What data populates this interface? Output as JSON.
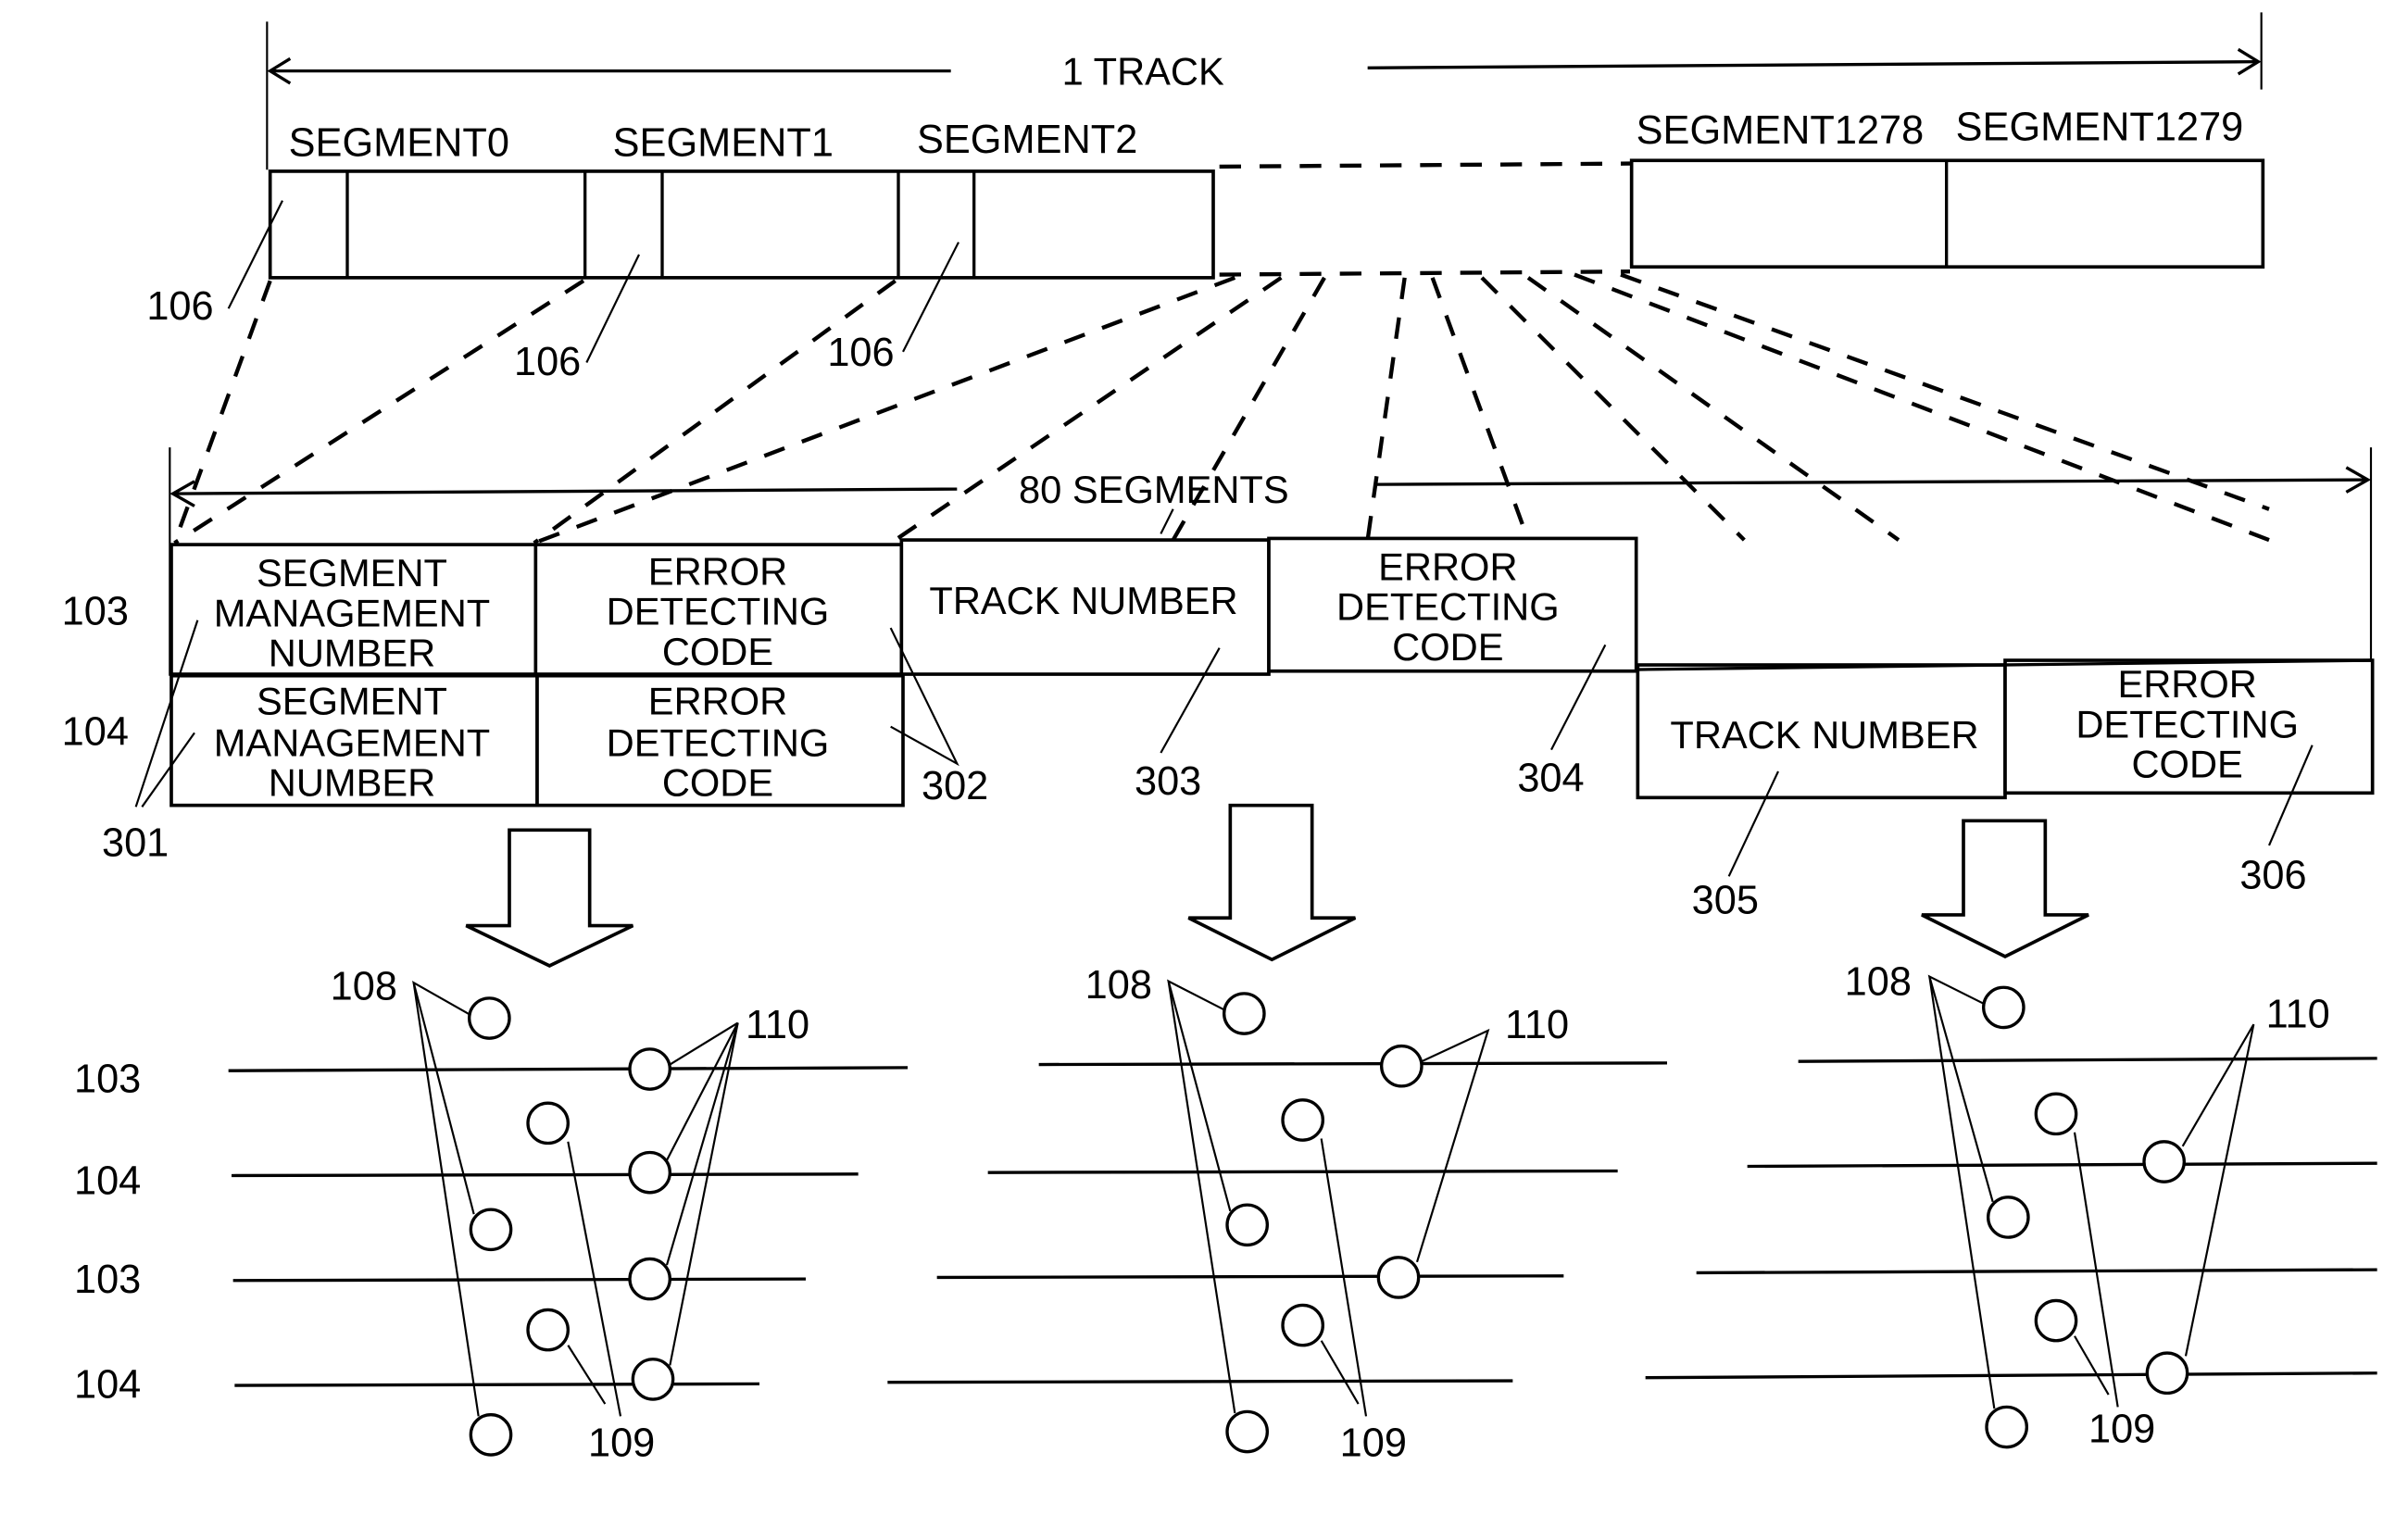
{
  "track": {
    "span_label": "1  TRACK",
    "segments": [
      "SEGMENT0",
      "SEGMENT1",
      "SEGMENT2",
      "SEGMENT1278",
      "SEGMENT1279"
    ],
    "segment_header_ref": "106"
  },
  "detail": {
    "span_label": "80  SEGMENTS",
    "row_labels": [
      "103",
      "104"
    ],
    "cells": {
      "smn": "SEGMENT|MANAGEMENT|NUMBER",
      "edc": "ERROR|DETECTING|CODE",
      "tn": "TRACK  NUMBER"
    },
    "refs": [
      "301",
      "302",
      "303",
      "304",
      "305",
      "306"
    ]
  },
  "arrangements": [
    {
      "row_labels": [
        "103",
        "104",
        "103",
        "104"
      ],
      "refs": [
        "108",
        "109",
        "110"
      ]
    },
    {
      "refs": [
        "108",
        "109",
        "110"
      ]
    },
    {
      "refs": [
        "108",
        "109",
        "110"
      ]
    }
  ]
}
